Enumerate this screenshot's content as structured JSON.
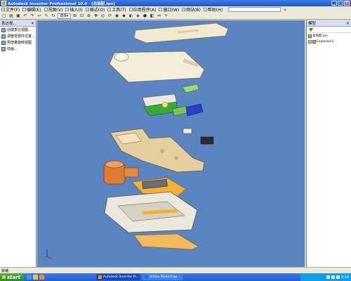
{
  "window": {
    "title": "Autodesk Inventor Professional 10.0 - [总装配.ipn]"
  },
  "menu": {
    "items": [
      "文件(F)",
      "编辑(E)",
      "视图(V)",
      "插入(I)",
      "格式(O)",
      "工具(T)",
      "应用程序(A)",
      "窗口(W)",
      "网站(B)",
      "帮助(H)"
    ],
    "more_label": "»"
  },
  "toolbar": {
    "select_label": "选择"
  },
  "left_panel": {
    "title": "表达视...",
    "close_label": "×",
    "items": [
      "创建表达视图...",
      "调整零部件位置...",
      "预增量旋转视图",
      "动画..."
    ]
  },
  "right_panel": {
    "title": "模型",
    "tree": [
      "总装配.ipn",
      "Explosion1"
    ]
  },
  "status": {
    "text": "就绪"
  },
  "taskbar": {
    "start_label": "start",
    "tasks": [
      "Autodesk Inventor Pr...",
      "Adobe Photoshop"
    ],
    "clock": "9:14"
  },
  "colors": {
    "viewport_bg": "#5a84c2",
    "titlebar": "#245edb",
    "part_cream": "#f2e9cf",
    "part_orange": "#e07b33",
    "part_green": "#3aa83a",
    "part_blue": "#2a3fc8",
    "part_yellow": "#f5b232"
  },
  "icons": [
    "app-icon",
    "filter-icon",
    "axis-triad-icon",
    "start-logo-icon"
  ]
}
